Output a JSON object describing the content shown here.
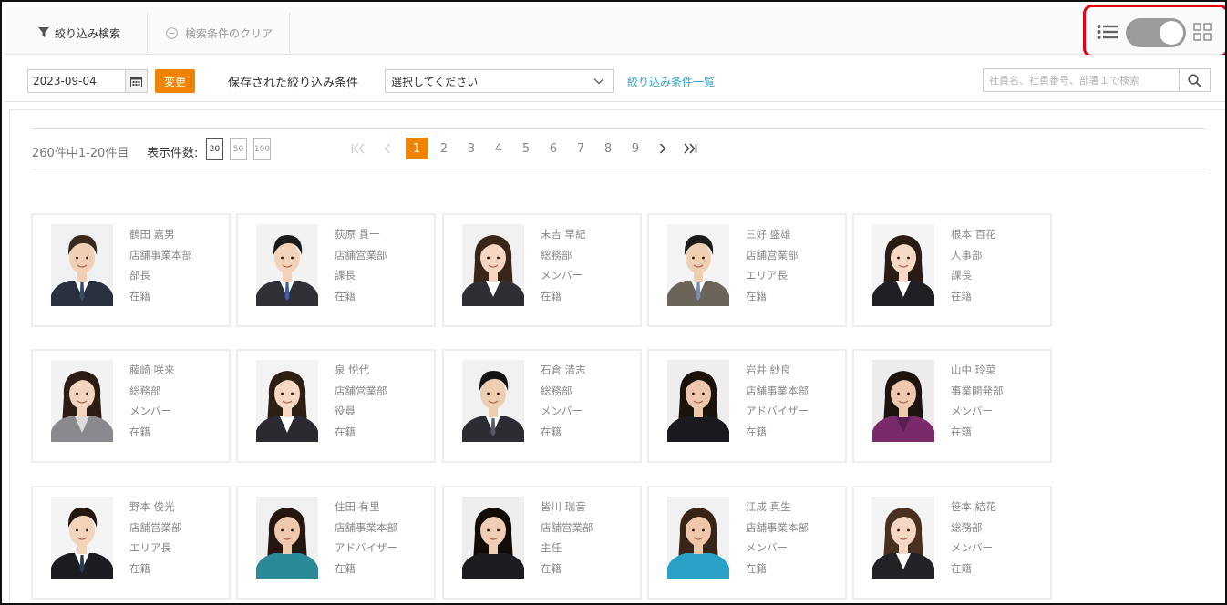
{
  "toolbar": {
    "filter_label": "絞り込み検索",
    "clear_label": "検索条件のクリア"
  },
  "filters": {
    "date_value": "2023-09-04",
    "change_label": "変更",
    "saved_label": "保存された絞り込み条件",
    "select_value": "選択してください",
    "list_link": "絞り込み条件一覧",
    "search_placeholder": "社員名、社員番号、部署１で検索"
  },
  "paging": {
    "count_text": "260件中1-20件目",
    "per_page_label": "表示件数:",
    "per_page_options": [
      "20",
      "50",
      "100"
    ],
    "pages": [
      "1",
      "2",
      "3",
      "4",
      "5",
      "6",
      "7",
      "8",
      "9"
    ],
    "current_page": "1"
  },
  "colors": {
    "accent": "#f08300",
    "link": "#2ea3c5",
    "highlight": "#e60012"
  },
  "employees": [
    {
      "name": "鶴田 嘉男",
      "dept": "店舗事業本部",
      "title": "部長",
      "status": "在籍",
      "gender": "m",
      "bg": "#eef0f2",
      "suit": "#2b3040",
      "hair": "#3a2a1e",
      "skin": "#f0cfb4",
      "tie": "#3b4a6b"
    },
    {
      "name": "荻原 貫一",
      "dept": "店舗営業部",
      "title": "課長",
      "status": "在籍",
      "gender": "m",
      "bg": "#f2f2f2",
      "suit": "#2f3136",
      "hair": "#1a1a1a",
      "skin": "#f2d2b8",
      "tie": "#3f5fa8"
    },
    {
      "name": "末吉 早紀",
      "dept": "総務部",
      "title": "メンバー",
      "status": "在籍",
      "gender": "f",
      "bg": "#f1f1f1",
      "suit": "#2e2e33",
      "hair": "#3a2618",
      "skin": "#f4d6c2",
      "tie": "#ffffff"
    },
    {
      "name": "三好 盛雄",
      "dept": "店舗営業部",
      "title": "エリア長",
      "status": "在籍",
      "gender": "m",
      "bg": "#f3f3f3",
      "suit": "#6b6458",
      "hair": "#1b1b1b",
      "skin": "#efcfb2",
      "tie": "#7a8fb0"
    },
    {
      "name": "根本 百花",
      "dept": "人事部",
      "title": "課長",
      "status": "在籍",
      "gender": "f",
      "bg": "#f4f4f4",
      "suit": "#1f1f24",
      "hair": "#2a1c14",
      "skin": "#f5d8c6",
      "tie": "#ffffff"
    },
    {
      "name": "藤崎 咲来",
      "dept": "総務部",
      "title": "メンバー",
      "status": "在籍",
      "gender": "f",
      "bg": "#f2f2f2",
      "suit": "#8a8a8e",
      "hair": "#2c1d14",
      "skin": "#f3d4c0",
      "tie": "#dcdcdc"
    },
    {
      "name": "泉 悦代",
      "dept": "店舗営業部",
      "title": "役員",
      "status": "在籍",
      "gender": "f",
      "bg": "#f3f3f3",
      "suit": "#2a2a30",
      "hair": "#2e1f15",
      "skin": "#f5d7c4",
      "tie": "#ffffff"
    },
    {
      "name": "石倉 清志",
      "dept": "総務部",
      "title": "メンバー",
      "status": "在籍",
      "gender": "m",
      "bg": "#f1f1f1",
      "suit": "#2c2d33",
      "hair": "#141414",
      "skin": "#efcdb0",
      "tie": "#555a66"
    },
    {
      "name": "岩井 紗良",
      "dept": "店舗事業本部",
      "title": "アドバイザー",
      "status": "在籍",
      "gender": "f",
      "bg": "#eeeeee",
      "suit": "#1a1a1e",
      "hair": "#1c120c",
      "skin": "#edc7ad",
      "tie": "#1a1a1e"
    },
    {
      "name": "山中 玲菜",
      "dept": "事業開発部",
      "title": "メンバー",
      "status": "在籍",
      "gender": "f",
      "bg": "#ececec",
      "suit": "#7a2a6a",
      "hair": "#1e140e",
      "skin": "#eec9b0",
      "tie": "#5a1f50"
    },
    {
      "name": "野本 俊光",
      "dept": "店舗営業部",
      "title": "エリア長",
      "status": "在籍",
      "gender": "m",
      "bg": "#f3f3f3",
      "suit": "#1c1d22",
      "hair": "#241710",
      "skin": "#f3d3ba",
      "tie": "#2f3a55"
    },
    {
      "name": "住田 有里",
      "dept": "店舗事業本部",
      "title": "アドバイザー",
      "status": "在籍",
      "gender": "f",
      "bg": "#f0f0f0",
      "suit": "#2a8a98",
      "hair": "#241610",
      "skin": "#efc9ae",
      "tie": "#2a8a98"
    },
    {
      "name": "皆川 瑞音",
      "dept": "店舗営業部",
      "title": "主任",
      "status": "在籍",
      "gender": "f",
      "bg": "#eeeeee",
      "suit": "#1c1c20",
      "hair": "#120c08",
      "skin": "#f0cdb4",
      "tie": "#1c1c20"
    },
    {
      "name": "江成 真生",
      "dept": "店舗事業本部",
      "title": "メンバー",
      "status": "在籍",
      "gender": "f",
      "bg": "#f1f1f1",
      "suit": "#2aa0c8",
      "hair": "#3a2416",
      "skin": "#efc8ac",
      "tie": "#2aa0c8"
    },
    {
      "name": "笹本 結花",
      "dept": "総務部",
      "title": "メンバー",
      "status": "在籍",
      "gender": "f",
      "bg": "#f4f4f4",
      "suit": "#222226",
      "hair": "#4a3020",
      "skin": "#f4d6c3",
      "tie": "#ffffff"
    }
  ]
}
